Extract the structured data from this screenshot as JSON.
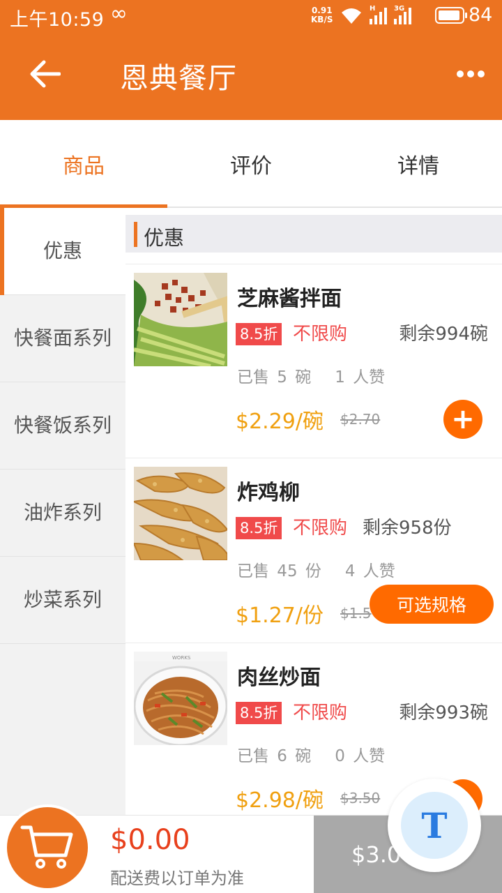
{
  "status_bar": {
    "time": "上午10:59",
    "infinity_glyph": "∞",
    "net_speed_value": "0.91",
    "net_speed_unit": "KB/S",
    "signal_1_tag": "H",
    "signal_2_tag": "3G",
    "battery": "84"
  },
  "header": {
    "title": "恩典餐厅",
    "back_icon": "back-arrow-icon",
    "more_icon": "more-dots-icon"
  },
  "tabs": [
    {
      "label": "商品",
      "active": true
    },
    {
      "label": "评价",
      "active": false
    },
    {
      "label": "详情",
      "active": false
    }
  ],
  "sidebar": {
    "items": [
      {
        "label": "优惠",
        "active": true
      },
      {
        "label": "快餐面系列",
        "active": false
      },
      {
        "label": "快餐饭系列",
        "active": false
      },
      {
        "label": "油炸系列",
        "active": false
      },
      {
        "label": "炒菜系列",
        "active": false
      }
    ]
  },
  "section": {
    "title": "优惠"
  },
  "products": [
    {
      "name": "芝麻酱拌面",
      "discount": "8.5折",
      "limit": "不限购",
      "stock": "剩余994碗",
      "sold": "已售 5 碗",
      "likes": "1 人赞",
      "price": "$2.29/碗",
      "original_price": "$2.70",
      "action": "+"
    },
    {
      "name": "炸鸡柳",
      "discount": "8.5折",
      "limit": "不限购",
      "stock": "剩余958份",
      "sold": "已售 45 份",
      "likes": "4 人赞",
      "price": "$1.27/份",
      "original_price": "$1.5",
      "action": "可选规格"
    },
    {
      "name": "肉丝炒面",
      "discount": "8.5折",
      "limit": "不限购",
      "stock": "剩余993碗",
      "sold": "已售 6 碗",
      "likes": "0 人赞",
      "price": "$2.98/碗",
      "original_price": "$3.50",
      "thumb_caption": "WORKS"
    }
  ],
  "bottom_bar": {
    "total": "$0.00",
    "delivery_note": "配送费以订单为准",
    "checkout_label": "$3.0"
  },
  "float_button": {
    "label": "T"
  },
  "colors": {
    "brand": "#ec7321",
    "price": "#f0a010",
    "discount": "#f04a4a",
    "action": "#ff6a00",
    "total": "#e8401c"
  }
}
